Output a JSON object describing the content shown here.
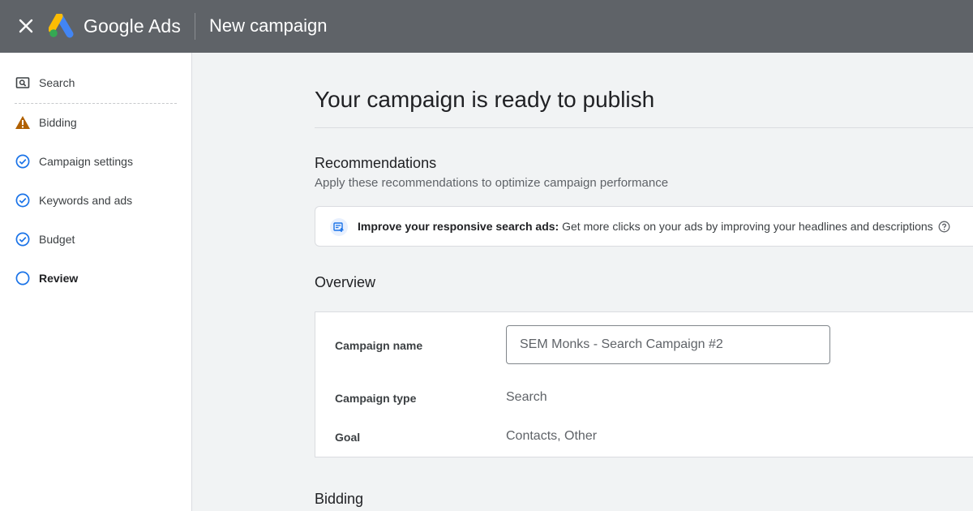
{
  "header": {
    "brand": "Google Ads",
    "title": "New campaign"
  },
  "sidebar": {
    "items": [
      {
        "label": "Search",
        "icon": "search-box-icon",
        "state": "normal"
      },
      {
        "label": "Bidding",
        "icon": "warning-icon",
        "state": "warning"
      },
      {
        "label": "Campaign settings",
        "icon": "check-circle-icon",
        "state": "done"
      },
      {
        "label": "Keywords and ads",
        "icon": "check-circle-icon",
        "state": "done"
      },
      {
        "label": "Budget",
        "icon": "check-circle-icon",
        "state": "done"
      },
      {
        "label": "Review",
        "icon": "empty-circle-icon",
        "state": "current"
      }
    ]
  },
  "main": {
    "heading": "Your campaign is ready to publish",
    "recommendations": {
      "title": "Recommendations",
      "subtitle": "Apply these recommendations to optimize campaign performance",
      "item_bold": "Improve your responsive search ads:",
      "item_text": " Get more clicks on your ads by improving your headlines and descriptions"
    },
    "overview": {
      "title": "Overview",
      "campaign_name_label": "Campaign name",
      "campaign_name_value": "SEM Monks - Search Campaign #2",
      "campaign_type_label": "Campaign type",
      "campaign_type_value": "Search",
      "goal_label": "Goal",
      "goal_value": "Contacts, Other"
    },
    "bidding_title": "Bidding"
  },
  "colors": {
    "topbar": "#5f6368",
    "accent_blue": "#1a73e8",
    "warning": "#b06000"
  }
}
